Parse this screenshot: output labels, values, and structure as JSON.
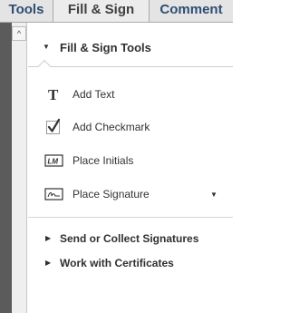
{
  "tabs": {
    "tools": "Tools",
    "fill_sign": "Fill & Sign",
    "comment": "Comment"
  },
  "panel": {
    "title": "Fill & Sign Tools",
    "items": [
      {
        "label": "Add Text",
        "icon": "text-icon"
      },
      {
        "label": "Add Checkmark",
        "icon": "checkmark-icon"
      },
      {
        "label": "Place Initials",
        "icon": "initials-icon"
      },
      {
        "label": "Place Signature",
        "icon": "signature-icon"
      }
    ],
    "sections": [
      {
        "label": "Send or Collect Signatures"
      },
      {
        "label": "Work with Certificates"
      }
    ]
  },
  "scroll": {
    "up_glyph": "^"
  }
}
